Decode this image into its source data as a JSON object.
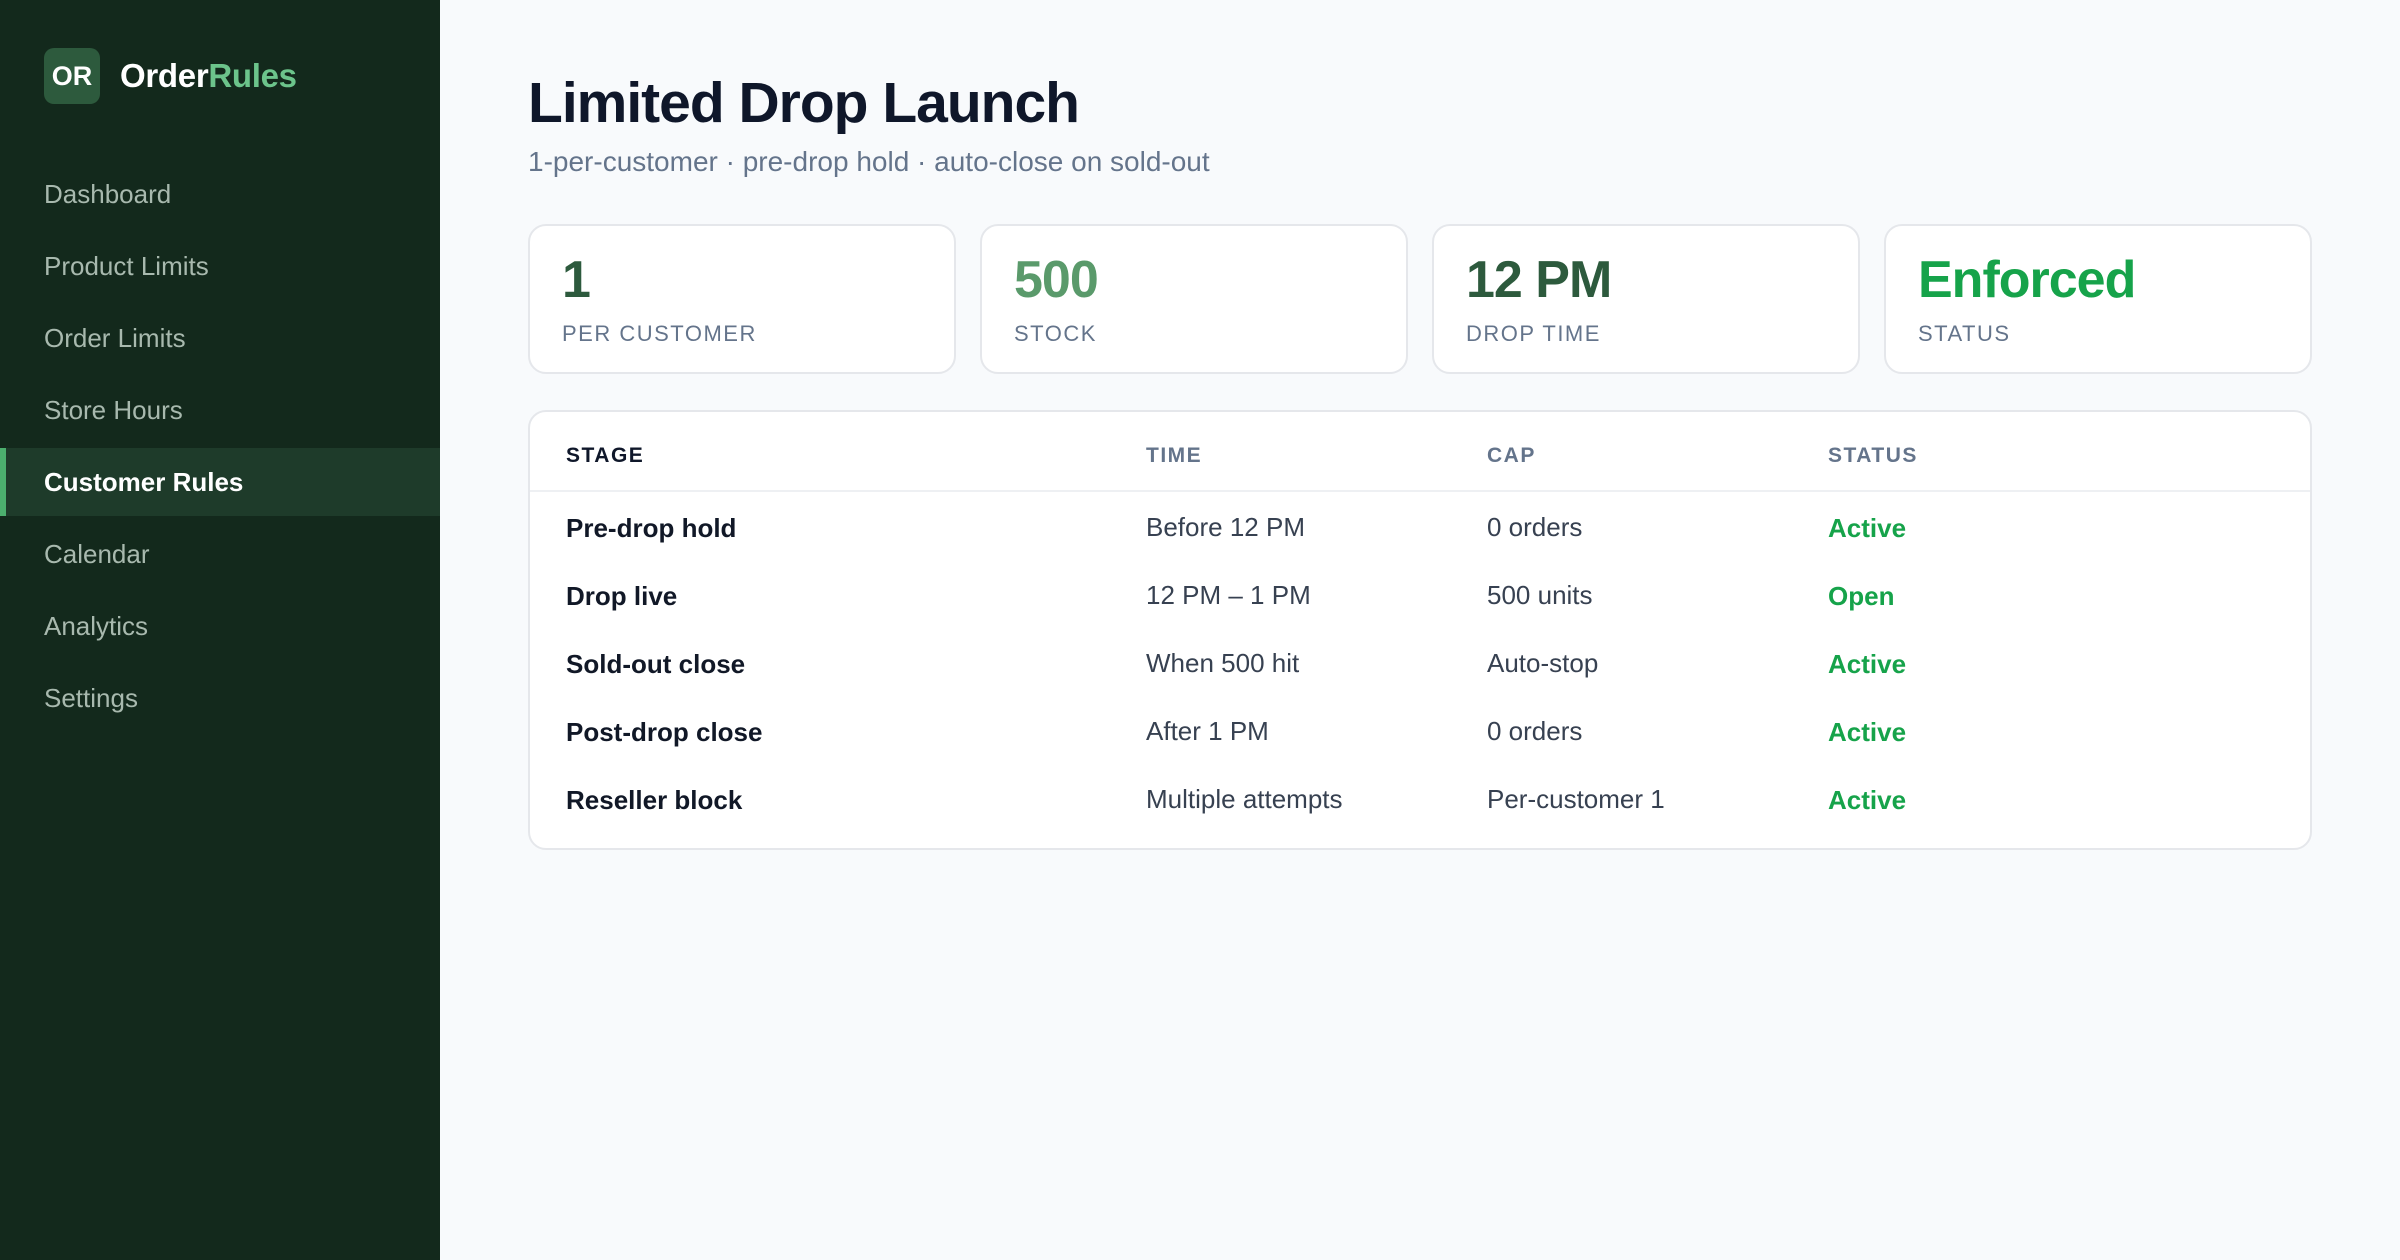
{
  "app": {
    "badge": "OR",
    "name_part1": "Order",
    "name_part2": "Rules"
  },
  "sidebar": {
    "items": [
      {
        "label": "Dashboard"
      },
      {
        "label": "Product Limits"
      },
      {
        "label": "Order Limits"
      },
      {
        "label": "Store Hours"
      },
      {
        "label": "Customer Rules",
        "active": true
      },
      {
        "label": "Calendar"
      },
      {
        "label": "Analytics"
      },
      {
        "label": "Settings"
      }
    ]
  },
  "page": {
    "title": "Limited Drop Launch",
    "subtitle": "1-per-customer · pre-drop hold · auto-close on sold-out"
  },
  "cards": [
    {
      "value": "1",
      "label": "PER CUSTOMER",
      "color": "#2d5a3d"
    },
    {
      "value": "500",
      "label": "STOCK",
      "color": "#5a9a6b"
    },
    {
      "value": "12 PM",
      "label": "DROP TIME",
      "color": "#2d5a3d"
    },
    {
      "value": "Enforced",
      "label": "STATUS",
      "color": "#16a34a"
    }
  ],
  "table": {
    "headers": [
      "STAGE",
      "TIME",
      "CAP",
      "STATUS"
    ],
    "rows": [
      {
        "stage": "Pre-drop hold",
        "time": "Before 12 PM",
        "cap": "0 orders",
        "status": "Active"
      },
      {
        "stage": "Drop live",
        "time": "12 PM – 1 PM",
        "cap": "500 units",
        "status": "Open"
      },
      {
        "stage": "Sold-out close",
        "time": "When 500 hit",
        "cap": "Auto-stop",
        "status": "Active"
      },
      {
        "stage": "Post-drop close",
        "time": "After 1 PM",
        "cap": "0 orders",
        "status": "Active"
      },
      {
        "stage": "Reseller block",
        "time": "Multiple attempts",
        "cap": "Per-customer 1",
        "status": "Active"
      }
    ]
  },
  "colors": {
    "sidebar_bg": "#13291c",
    "accent": "#4caf6e",
    "status_green": "#16a34a"
  }
}
